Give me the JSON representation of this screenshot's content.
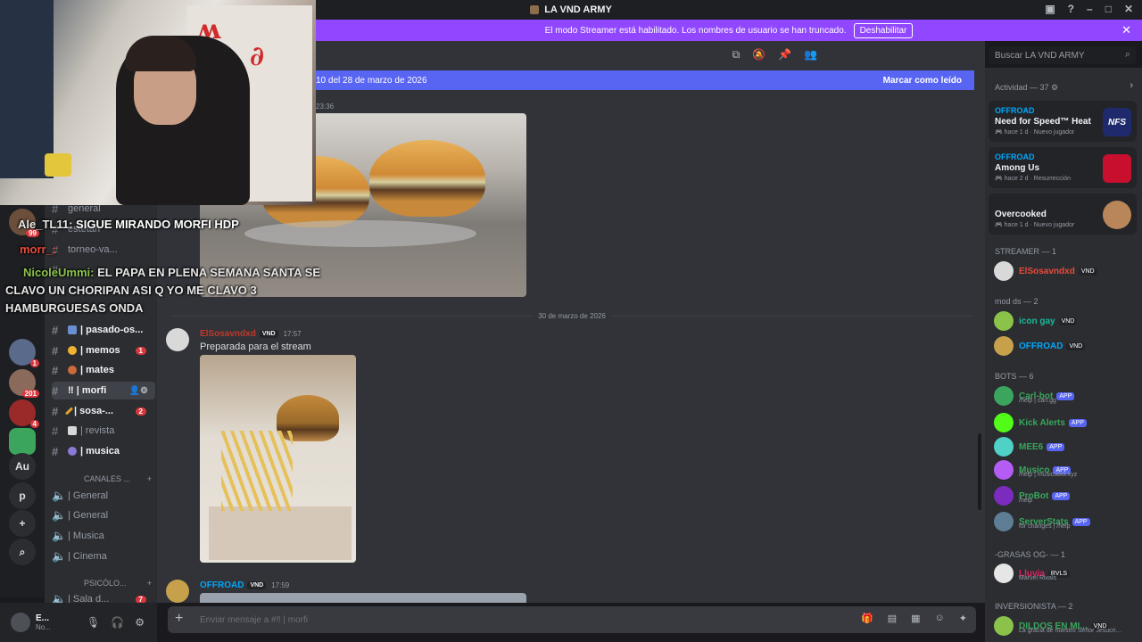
{
  "window": {
    "title": "LA VND ARMY"
  },
  "streamer_banner": {
    "text": "El modo Streamer está habilitado. Los nombres de usuario se han truncado.",
    "button": "Deshabilitar"
  },
  "overlay_chat": [
    {
      "name": "Ale_TL11:",
      "text": "SIGUE MIRANDO MORFI HDP"
    },
    {
      "name": "morr_:",
      "text": ""
    },
    {
      "name": "NicoleUmmi:",
      "text": "EL PAPA EN PLENA SEMANA SANTA SE"
    },
    {
      "name": "",
      "text": "CLAVO UN CHORIPAN ASI Q YO ME CLAVO 3"
    },
    {
      "name": "",
      "text": "HAMBURGUESAS ONDA"
    }
  ],
  "servers": [
    {
      "badge": "99"
    },
    {
      "badge": "1"
    },
    {
      "badge": "201"
    },
    {
      "badge": "4"
    },
    {
      "badge": ""
    }
  ],
  "server_texts": [
    "Au",
    "p",
    "+",
    "⌕"
  ],
  "channels": [
    {
      "label": "general"
    },
    {
      "label": "estetan"
    },
    {
      "label": "torneo-va..."
    },
    {
      "label": ""
    },
    {
      "label": "| pasado-os...",
      "unread": true
    },
    {
      "label": "| memos",
      "count": "1",
      "unread": true
    },
    {
      "label": "| mates",
      "unread": true
    },
    {
      "label": "‼ | morfi",
      "active": true
    },
    {
      "label": "| sosa-...",
      "count": "2",
      "unread": true
    },
    {
      "label": "| revista"
    },
    {
      "label": "| musica",
      "unread": true
    }
  ],
  "voice_category": "CANALES ...",
  "voice_channels": [
    "| General",
    "| General",
    "| Musica",
    "| Cinema"
  ],
  "psico_category": "PSICÓLO...",
  "psico_channel": "| Sala d...",
  "psico_count": "7",
  "user": {
    "name": "E...",
    "status": "No..."
  },
  "new_messages": {
    "text": "10 del 28 de marzo de 2026",
    "mark_read": "Marcar como leído"
  },
  "messages": {
    "first_time": "23:36",
    "date_divider": "30 de marzo de 2026",
    "msg1": {
      "author": "ElSosavndxd",
      "tag": "VND",
      "time": "17:57",
      "text": "Preparada para el stream"
    },
    "msg2": {
      "author": "OFFROAD",
      "tag": "VND",
      "time": "17:59"
    }
  },
  "composer": {
    "placeholder": "Enviar mensaje a #‼ | morfi"
  },
  "search": {
    "placeholder": "Buscar LA VND ARMY"
  },
  "members": {
    "activity_header": "Actividad — 37",
    "activities": [
      {
        "name": "OFFROAD",
        "game": "Need for Speed™ Heat",
        "meta": "🎮 hace 1 d · Nuevo jugador",
        "thumb": "NFS"
      },
      {
        "name": "OFFROAD",
        "game": "Among Us",
        "meta": "🎮 hace 2 d · Resurrección",
        "thumb": ""
      },
      {
        "name": "",
        "game": "Overcooked",
        "meta": "🎮 hace 1 d · Nuevo jugador",
        "thumb": ""
      }
    ],
    "streamer_header": "STREAMER — 1",
    "streamer": {
      "name": "ElSosavndxd",
      "tag": "VND"
    },
    "mods_header": "mod ds — 2",
    "mods": [
      {
        "name": "icon gay",
        "tag": "VND"
      },
      {
        "name": "OFFROAD",
        "tag": "VND"
      }
    ],
    "bots_header": "BOTS — 6",
    "bots": [
      {
        "name": "Carl-bot",
        "tag": "APP",
        "sub": "/help | carl.gg",
        "color": "#3ba55d"
      },
      {
        "name": "Kick Alerts",
        "tag": "APP",
        "sub": "",
        "color": "#53fc18"
      },
      {
        "name": "MEE6",
        "tag": "APP",
        "sub": "",
        "color": "#4fd1c5"
      },
      {
        "name": "Musico",
        "tag": "APP",
        "sub": "/help | musicobot.xyz",
        "color": "#b55cf5"
      },
      {
        "name": "ProBot",
        "tag": "APP",
        "sub": "/help",
        "color": "#7b2cbf"
      },
      {
        "name": "ServerStats",
        "tag": "APP",
        "sub": "for changes | /help",
        "color": "#5f7d95"
      }
    ],
    "grasas_header": "-GRASAS OG- — 1",
    "grasas": {
      "name": "Lluvia",
      "tag": "RVLS",
      "sub": "Marvel Rivals"
    },
    "inv_header": "INVERSIONISTA — 2",
    "inv": {
      "name": "DILDOS EN MI...",
      "tag": "VND",
      "sub": "La gracia de nuestro Señor Jesucri..."
    }
  }
}
